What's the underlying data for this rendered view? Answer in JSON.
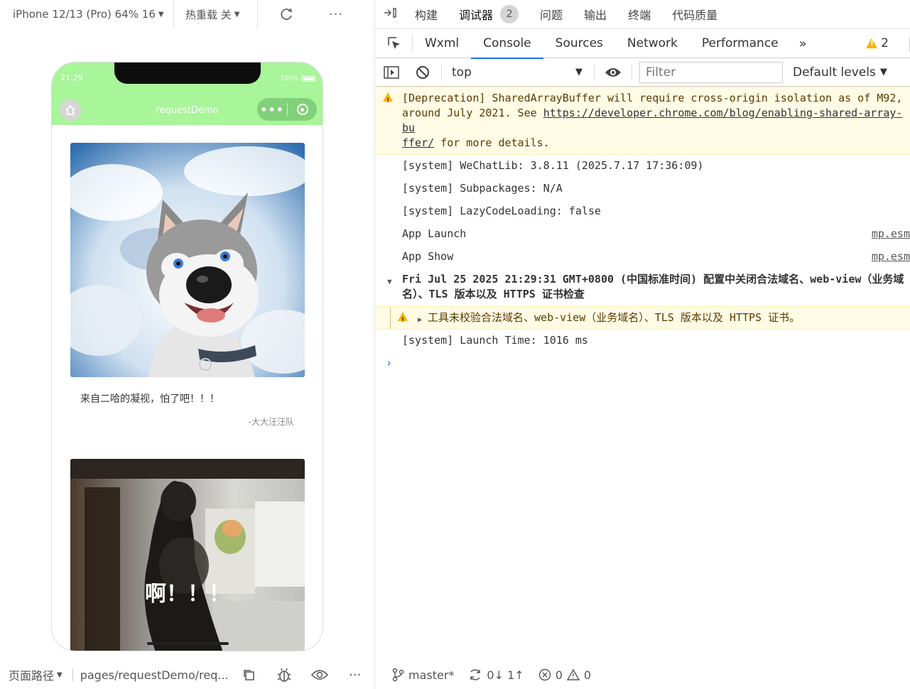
{
  "simulator": {
    "device_label": "iPhone 12/13 (Pro) 64% 16",
    "hot_reload_label": "热重载 关",
    "refresh_icon": "refresh-icon",
    "more_label": "···",
    "status_time": "21:29",
    "battery_label": "100%",
    "nav_title": "requestDemo",
    "capsule_more": "•••",
    "cards": [
      {
        "caption": "来自二哈的凝视，怕了吧！！！",
        "author": "-大大汪汪队"
      },
      {
        "overlay_text": "啊！！！"
      }
    ],
    "bottom": {
      "path_label": "页面路径",
      "path_value": "pages/requestDemo/req...",
      "more_label": "···"
    }
  },
  "devtools": {
    "top_tabs": [
      {
        "label": "构建"
      },
      {
        "label": "调试器",
        "badge": "2"
      },
      {
        "label": "问题"
      },
      {
        "label": "输出"
      },
      {
        "label": "终端"
      },
      {
        "label": "代码质量"
      }
    ],
    "panel_tabs": [
      "Wxml",
      "Console",
      "Sources",
      "Network",
      "Performance"
    ],
    "active_panel": "Console",
    "more_tabs": "»",
    "warning_count": "2",
    "filter": {
      "context": "top",
      "placeholder": "Filter",
      "levels": "Default levels"
    },
    "console": {
      "deprecation": {
        "prefix": "[Deprecation] SharedArrayBuffer will require cross-origin isolation as of M92,",
        "line2_pre": "around July 2021. See ",
        "link": "https://developer.chrome.com/blog/enabling-shared-array-bu",
        "link_tail": "ffer/",
        "suffix": " for more details."
      },
      "lines": [
        {
          "text": "[system] WeChatLib: 3.8.11 (2025.7.17 17:36:09)"
        },
        {
          "text": "[system] Subpackages: N/A"
        },
        {
          "text": "[system] LazyCodeLoading: false"
        },
        {
          "text": "App Launch",
          "src": "mp.esm"
        },
        {
          "text": "App Show",
          "src": "mp.esm"
        }
      ],
      "group_header": "Fri Jul 25 2025 21:29:31 GMT+0800 (中国标准时间) 配置中关闭合法域名、web-view（业务域名）、TLS 版本以及 HTTPS 证书检查",
      "group_warning": "工具未校验合法域名、web-view（业务域名）、TLS 版本以及 HTTPS 证书。",
      "launch_time": "[system] Launch Time: 1016 ms",
      "prompt": "›"
    },
    "status": {
      "branch": "master*",
      "sync": "0↓ 1↑",
      "errors": "0",
      "warnings": "0"
    }
  }
}
